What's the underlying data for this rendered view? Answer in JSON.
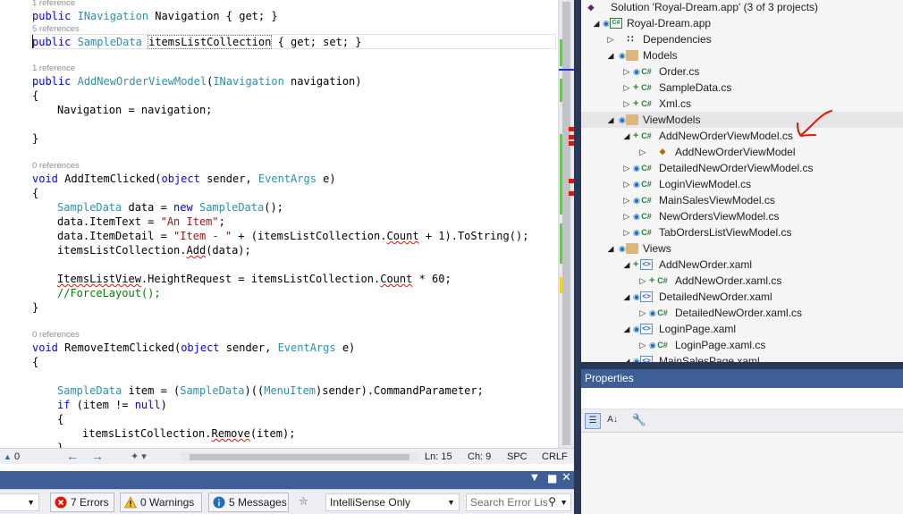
{
  "editor": {
    "lens_1": "1 reference",
    "lens_5": "5 references",
    "lens_ctor": "1 reference",
    "lens_add": "0 references",
    "lens_remove": "0 references",
    "code": {
      "public": "public",
      "navigation_type": "INavigation",
      "navigation_decl": " Navigation { get; }",
      "sampledata_type": "SampleData",
      "items_prop": "itemsListCollection",
      "items_prop_rest": " { get; set; }",
      "ctor_name": "AddNewOrderViewModel",
      "ctor_param_type": "INavigation",
      "ctor_param": " navigation)",
      "open_paren": "(",
      "brace_open": "{",
      "brace_close": "}",
      "nav_assign": "Navigation = navigation;",
      "void": "void",
      "add_name": " AddItemClicked(",
      "object": "object",
      "sender": " sender, ",
      "eventargs": "EventArgs",
      "e_close": " e)",
      "data_decl": " data = ",
      "new": "new",
      "sampledata_ctor": "SampleData",
      "ctor_end": "();",
      "item_text_pre": "data.ItemText = ",
      "item_text_str": "\"An Item\"",
      "semicolon": ";",
      "item_detail_pre": "data.ItemDetail = ",
      "item_detail_str": "\"Item - \"",
      "item_detail_mid": " + (itemsListCollection.",
      "count": "Count",
      "item_detail_end": " + 1).ToString();",
      "add_pre": "itemsListCollection.",
      "add_method": "Add",
      "add_end": "(data);",
      "itemslistview": "ItemsListView",
      "height_mid": ".HeightRequest = itemsListCollection.",
      "height_end": " * 60;",
      "comment": "//ForceLayout();",
      "remove_name": " RemoveItemClicked(",
      "item_decl": " item = (",
      "cast_close": ")((",
      "menuitem": "MenuItem",
      "cmd_param": ")sender).CommandParameter;",
      "if": "if",
      "if_cond": " (item != ",
      "null": "null",
      "if_end": ")",
      "remove_pre": "itemsListCollection.",
      "remove_method": "Remove",
      "remove_end": "(item);"
    },
    "status": {
      "errors_count": "0",
      "position_line": "Ln: 15",
      "position_char": "Ch: 9",
      "mode": "SPC",
      "line_ending": "CRLF"
    }
  },
  "error_list": {
    "errors": "7 Errors",
    "warnings": "0 Warnings",
    "messages": "5 Messages",
    "filter": "IntelliSense Only",
    "search_placeholder": "Search Error Lis"
  },
  "solution_explorer": {
    "items": [
      {
        "label": "Solution 'Royal-Dream.app' (3 of 3 projects)",
        "icon": "solution-icon"
      },
      {
        "label": "Royal-Dream.app",
        "icon": "csharp-project-icon"
      },
      {
        "label": "Dependencies",
        "icon": "dependencies-icon"
      },
      {
        "label": "Models",
        "icon": "folder-icon"
      },
      {
        "label": "Order.cs",
        "icon": "csharp-file-icon"
      },
      {
        "label": "SampleData.cs",
        "icon": "csharp-file-icon"
      },
      {
        "label": "Xml.cs",
        "icon": "csharp-file-icon"
      },
      {
        "label": "ViewModels",
        "icon": "folder-icon"
      },
      {
        "label": "AddNewOrderViewModel.cs",
        "icon": "csharp-file-icon"
      },
      {
        "label": "AddNewOrderViewModel",
        "icon": "class-icon"
      },
      {
        "label": "DetailedNewOrderViewModel.cs",
        "icon": "csharp-file-icon"
      },
      {
        "label": "LoginViewModel.cs",
        "icon": "csharp-file-icon"
      },
      {
        "label": "MainSalesViewModel.cs",
        "icon": "csharp-file-icon"
      },
      {
        "label": "NewOrdersViewModel.cs",
        "icon": "csharp-file-icon"
      },
      {
        "label": "TabOrdersListViewModel.cs",
        "icon": "csharp-file-icon"
      },
      {
        "label": "Views",
        "icon": "folder-icon"
      },
      {
        "label": "AddNewOrder.xaml",
        "icon": "xaml-file-icon"
      },
      {
        "label": "AddNewOrder.xaml.cs",
        "icon": "csharp-file-icon"
      },
      {
        "label": "DetailedNewOrder.xaml",
        "icon": "xaml-file-icon"
      },
      {
        "label": "DetailedNewOrder.xaml.cs",
        "icon": "csharp-file-icon"
      },
      {
        "label": "LoginPage.xaml",
        "icon": "xaml-file-icon"
      },
      {
        "label": "LoginPage.xaml.cs",
        "icon": "csharp-file-icon"
      },
      {
        "label": "MainSalesPage.xaml",
        "icon": "xaml-file-icon"
      }
    ],
    "file_glyph": "C#"
  },
  "properties": {
    "title": "Properties"
  },
  "colors": {
    "keyword": "#0000ff",
    "type": "#2b91af",
    "string": "#a31515",
    "comment": "#008000",
    "error": "#e51400",
    "panel_title": "#3e5f96",
    "frame": "#293955",
    "annotation": "#e51400"
  }
}
